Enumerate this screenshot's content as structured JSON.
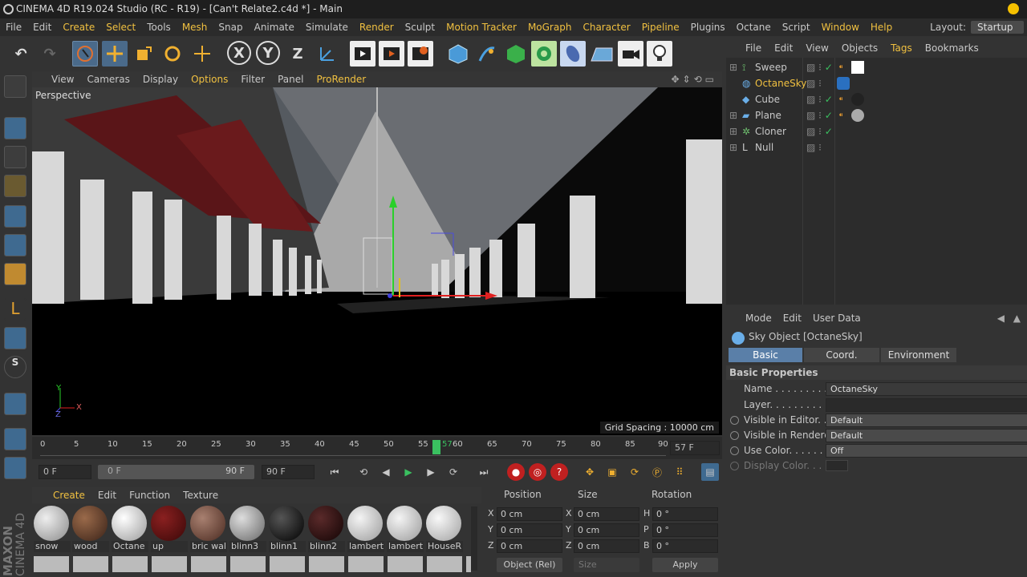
{
  "window": {
    "title": "CINEMA 4D R19.024 Studio (RC - R19) - [Can't Relate2.c4d *] - Main"
  },
  "menubar": {
    "items": [
      "File",
      "Edit",
      "Create",
      "Select",
      "Tools",
      "Mesh",
      "Snap",
      "Animate",
      "Simulate",
      "Render",
      "Sculpt",
      "Motion Tracker",
      "MoGraph",
      "Character",
      "Pipeline",
      "Plugins",
      "Octane",
      "Script",
      "Window",
      "Help"
    ],
    "layout_label": "Layout:",
    "layout_value": "Startup"
  },
  "toolbar": {
    "axis_x": "X",
    "axis_y": "Y",
    "axis_z": "Z"
  },
  "viewport": {
    "menu": [
      "View",
      "Cameras",
      "Display",
      "Options",
      "Filter",
      "Panel",
      "ProRender"
    ],
    "label": "Perspective",
    "grid_spacing": "Grid Spacing : 10000 cm",
    "axis_y": "Y",
    "axis_x": "X",
    "axis_z": "Z"
  },
  "timeline": {
    "ticks": [
      "0",
      "5",
      "10",
      "15",
      "20",
      "25",
      "30",
      "35",
      "40",
      "45",
      "50",
      "55",
      "60",
      "65",
      "70",
      "75",
      "80",
      "85",
      "90"
    ],
    "current": "57",
    "end_field": "57 F"
  },
  "playbar": {
    "start": "0 F",
    "range_start": "0 F",
    "range_end": "90 F",
    "end": "90 F"
  },
  "materials": {
    "menu": [
      "Create",
      "Edit",
      "Function",
      "Texture"
    ],
    "items": [
      {
        "name": "snow",
        "color": "#bdbdbd"
      },
      {
        "name": "wood",
        "color": "#5a3a2a"
      },
      {
        "name": "Octane",
        "color": "#cfcfcf"
      },
      {
        "name": "up",
        "color": "#5a1010"
      },
      {
        "name": "bric wal",
        "color": "#6b4a40"
      },
      {
        "name": "blinn3",
        "color": "#9a9a9a"
      },
      {
        "name": "blinn1",
        "color": "#1c1c1c"
      },
      {
        "name": "blinn2",
        "color": "#3a1a1a"
      },
      {
        "name": "lamberti",
        "color": "#c8c8c8"
      },
      {
        "name": "lambert.",
        "color": "#c8c8c8"
      },
      {
        "name": "HouseR",
        "color": "#d0d0d0"
      }
    ]
  },
  "coords": {
    "headers": [
      "Position",
      "Size",
      "Rotation"
    ],
    "pos": [
      "0 cm",
      "0 cm",
      "0 cm"
    ],
    "size": [
      "0 cm",
      "0 cm",
      "0 cm"
    ],
    "rot": [
      "0 °",
      "0 °",
      "0 °"
    ],
    "pos_axes": [
      "X",
      "Y",
      "Z"
    ],
    "size_axes": [
      "X",
      "Y",
      "Z"
    ],
    "rot_axes": [
      "H",
      "P",
      "B"
    ],
    "mode": "Object (Rel)",
    "size_mode": "Size",
    "apply": "Apply"
  },
  "objects": {
    "menu": [
      "File",
      "Edit",
      "View",
      "Objects",
      "Tags",
      "Bookmarks"
    ],
    "items": [
      {
        "name": "Sweep",
        "color": "#6fc06f",
        "selected": false
      },
      {
        "name": "OctaneSky",
        "color": "#f0c040",
        "selected": true
      },
      {
        "name": "Cube",
        "color": "#6aaee8",
        "selected": false
      },
      {
        "name": "Plane",
        "color": "#6aaee8",
        "selected": false
      },
      {
        "name": "Cloner",
        "color": "#6fc06f",
        "selected": false
      },
      {
        "name": "Null",
        "color": "#ccc",
        "selected": false
      }
    ]
  },
  "attributes": {
    "menu": [
      "Mode",
      "Edit",
      "User Data"
    ],
    "title": "Sky Object [OctaneSky]",
    "tabs": [
      "Basic",
      "Coord.",
      "Environment Tag"
    ],
    "section": "Basic Properties",
    "props": [
      {
        "label": "Name . . . . . . . . . . .",
        "value": "OctaneSky"
      },
      {
        "label": "Layer. . . . . . . . . . . .",
        "value": ""
      },
      {
        "label": "Visible in Editor. . .",
        "value": "Default"
      },
      {
        "label": "Visible in Renderer",
        "value": "Default"
      },
      {
        "label": "Use Color. . . . . . . .",
        "value": "Off"
      },
      {
        "label": "Display Color. . . .",
        "value": ""
      }
    ]
  },
  "brand": {
    "maxon": "MAXON",
    "c4d": "CINEMA 4D"
  }
}
